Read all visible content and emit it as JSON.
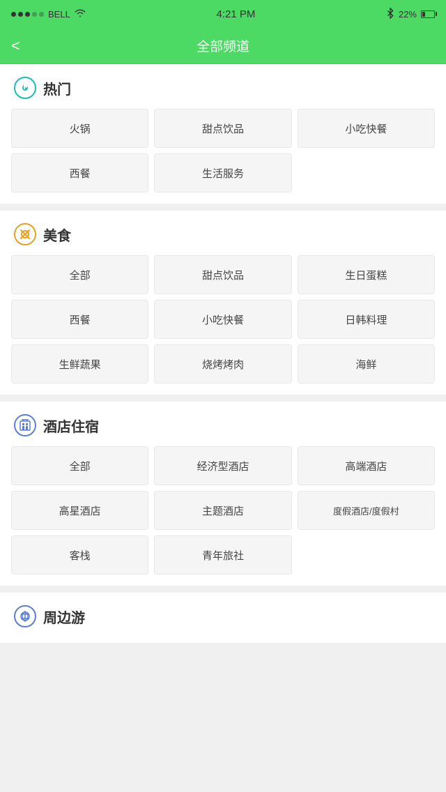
{
  "statusBar": {
    "carrier": "BELL",
    "time": "4:21 PM",
    "battery": "22%"
  },
  "navBar": {
    "backLabel": "<",
    "title": "全部频道"
  },
  "sections": [
    {
      "id": "hot",
      "iconType": "hot",
      "title": "热门",
      "items": [
        "火锅",
        "甜点饮品",
        "小吃快餐",
        "西餐",
        "生活服务"
      ]
    },
    {
      "id": "food",
      "iconType": "food",
      "title": "美食",
      "items": [
        "全部",
        "甜点饮品",
        "生日蛋糕",
        "西餐",
        "小吃快餐",
        "日韩料理",
        "生鲜蔬果",
        "烧烤烤肉",
        "海鲜"
      ]
    },
    {
      "id": "hotel",
      "iconType": "hotel",
      "title": "酒店住宿",
      "items": [
        "全部",
        "经济型酒店",
        "高端酒店",
        "高星酒店",
        "主题酒店",
        "度假酒店/度假村",
        "客栈",
        "青年旅社"
      ]
    },
    {
      "id": "travel",
      "iconType": "travel",
      "title": "周边游",
      "items": []
    }
  ]
}
